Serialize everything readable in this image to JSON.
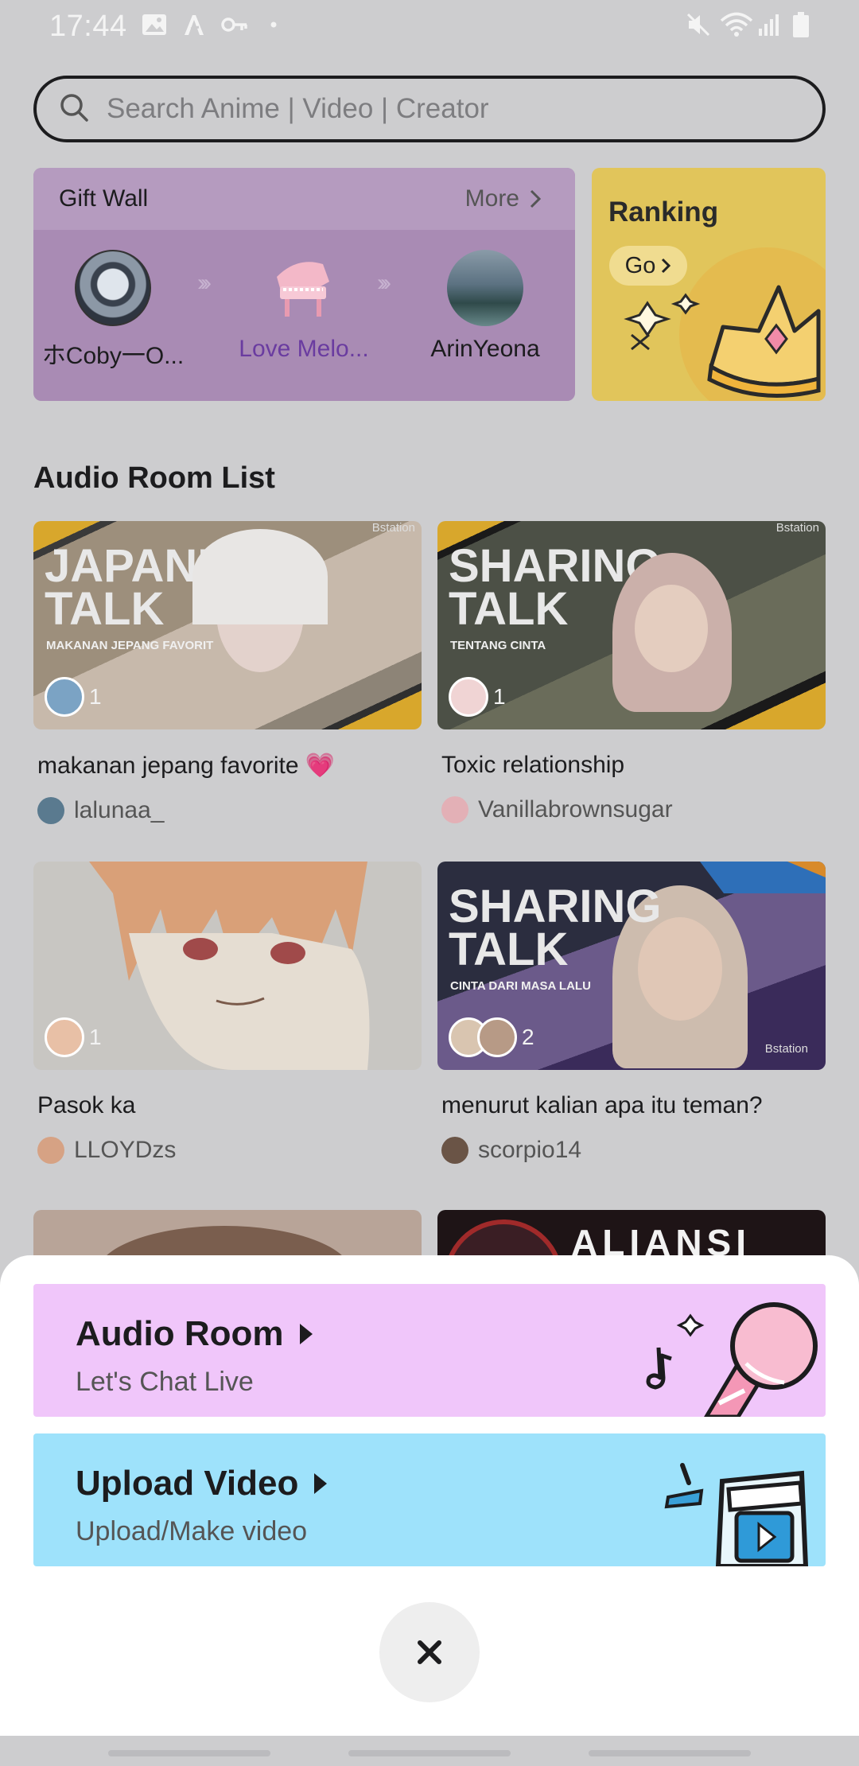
{
  "status_bar": {
    "time": "17:44"
  },
  "search": {
    "placeholder": "Search Anime | Video | Creator"
  },
  "gift_wall": {
    "title": "Gift Wall",
    "more_label": "More",
    "sender": "ホCoby一O...",
    "gift": "Love Melo...",
    "receiver": "ArinYeona"
  },
  "ranking": {
    "title": "Ranking",
    "go_label": "Go"
  },
  "section": {
    "title": "Audio Room List"
  },
  "rooms": [
    {
      "title": "makanan jepang favorite 💗",
      "user": "lalunaa_",
      "count": "1",
      "banner": "JAPANESE TALK",
      "banner_line1": "JAPANESE",
      "banner_line2": "TALK",
      "sub": "MAKANAN JEPANG FAVORIT",
      "watermark": "Bstation"
    },
    {
      "title": "Toxic relationship",
      "user": "Vanillabrownsugar",
      "count": "1",
      "banner_line1": "SHARING",
      "banner_line2": "TALK",
      "sub": "TENTANG CINTA",
      "watermark": "Bstation"
    },
    {
      "title": "Pasok ka",
      "user": "LLOYDzs",
      "count": "1"
    },
    {
      "title": "menurut kalian apa itu teman?",
      "user": "scorpio14",
      "count": "2",
      "banner_line1": "SHARING",
      "banner_line2": "TALK",
      "sub": "CINTA DARI MASA LALU",
      "watermark": "Bstation"
    }
  ],
  "partial_card": {
    "banner": "ALIANSI"
  },
  "sheet": {
    "audio_room": {
      "title": "Audio Room",
      "subtitle": "Let's Chat Live",
      "color": "#f0c6fa"
    },
    "upload_video": {
      "title": "Upload Video",
      "subtitle": "Upload/Make video",
      "color": "#9ee2fb"
    }
  }
}
